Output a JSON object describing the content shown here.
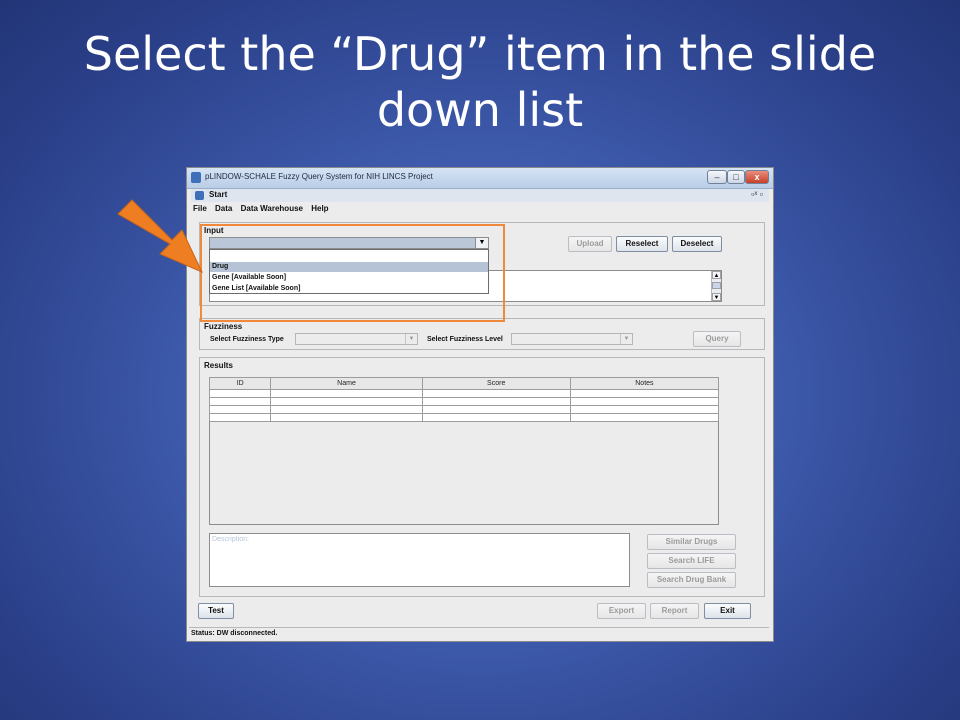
{
  "slide": {
    "title": "Select the “Drug” item in the slide down list"
  },
  "window": {
    "title": "pLINDOW-SCHALE Fuzzy Query System for NIH LINCS Project",
    "inner_title": "Start",
    "controls": {
      "minimize": "–",
      "maximize": "□",
      "close": "x",
      "inner": "▫ˣ ▫"
    }
  },
  "menu": [
    "File",
    "Data",
    "Data Warehouse",
    "Help"
  ],
  "input": {
    "label": "Input",
    "upload": "Upload",
    "reselect": "Reselect",
    "deselect": "Deselect",
    "dropdown_items": [
      "",
      "Drug",
      "Gene       [Available Soon]",
      "Gene List [Available Soon]"
    ],
    "selected_item": "Drug"
  },
  "fuzziness": {
    "label": "Fuzziness",
    "type_label": "Select Fuzziness Type",
    "level_label": "Select Fuzziness Level",
    "query": "Query"
  },
  "results": {
    "label": "Results",
    "columns": [
      "ID",
      "Name",
      "Score",
      "Notes"
    ],
    "description_placeholder": "Description:",
    "similar_drugs": "Similar Drugs",
    "search_life": "Search LIFE",
    "search_drug_bank": "Search Drug Bank"
  },
  "footer": {
    "test": "Test",
    "export": "Export",
    "report": "Report",
    "exit": "Exit",
    "status": "Status: DW disconnected."
  },
  "colors": {
    "highlight": "#f08a3a",
    "arrow": "#ef7d22",
    "background": "#3f5cae"
  }
}
